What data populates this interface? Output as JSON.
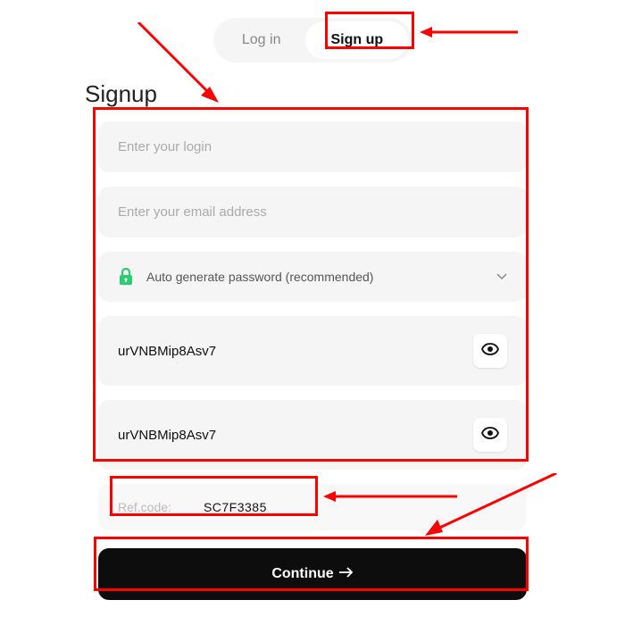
{
  "tabs": {
    "login": "Log in",
    "signup": "Sign up"
  },
  "page_title": "Signup",
  "form": {
    "login_placeholder": "Enter your login",
    "email_placeholder": "Enter your email address",
    "password_mode": "Auto generate password (recommended)",
    "password1": "urVNBMip8Asv7",
    "password2": "urVNBMip8Asv7",
    "refcode_label": "Ref.code:",
    "refcode_value": "SC7F3385",
    "continue_label": "Continue"
  }
}
